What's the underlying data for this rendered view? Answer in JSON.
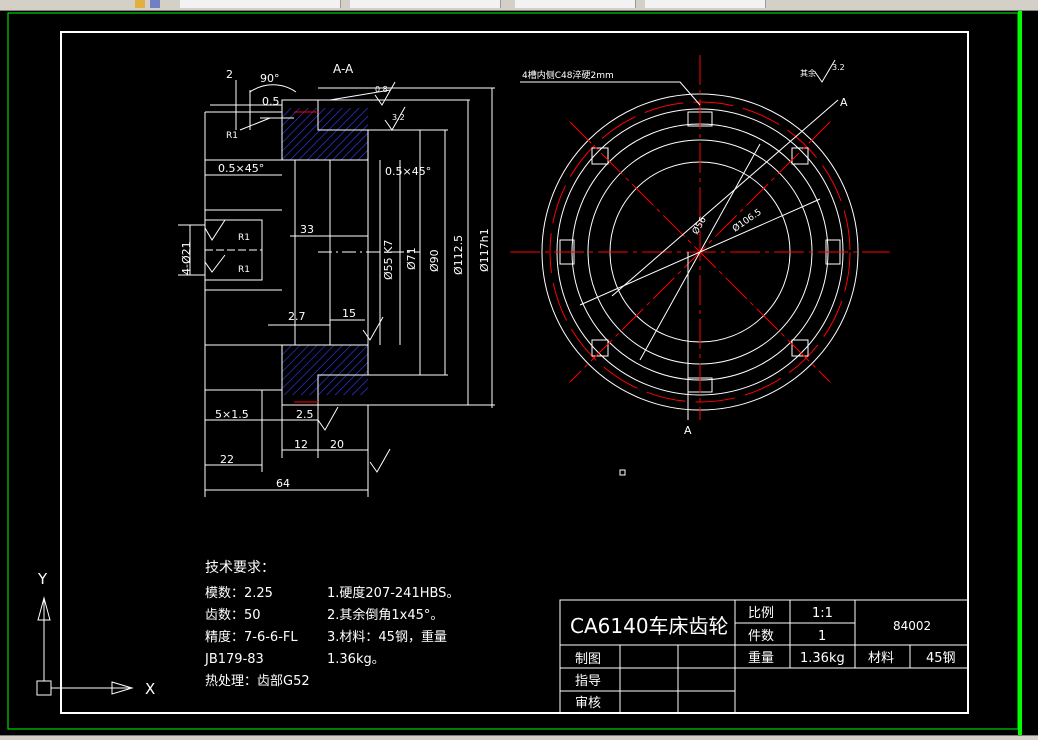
{
  "section_label": "A-A",
  "cut_marks": [
    "A",
    "A"
  ],
  "dimensions": {
    "angle": "90°",
    "chamfer_top": "0.5",
    "small_2": "2",
    "chamfer_left": "0.5×45°",
    "chamfer_right": "0.5×45°",
    "dim_33": "33",
    "bore_k7": "Ø55 K7",
    "phi_71": "Ø71",
    "phi_90": "Ø90",
    "phi_1125": "Ø112.5",
    "phi_117": "Ø117h1",
    "dim_27": "2.7",
    "dim_15": "15",
    "dim_5x15": "5×1.5",
    "dim_25": "2.5",
    "dim_12": "12",
    "dim_20": "20",
    "dim_22": "22",
    "dim_64": "64",
    "left_dim": "4-Ø21",
    "r1_a": "R1",
    "r1_b": "R1",
    "r1_c": "R1",
    "rough_08": "0.8",
    "rough_32": "3.2",
    "circle_note": "4槽内侧C48淬硬2mm",
    "phi_circle_a": "Ø56",
    "phi_circle_b": "Ø106.5",
    "other": "其余"
  },
  "tech_req": {
    "title": "技术要求：",
    "left_lines": [
      "模数：2.25",
      "齿数：50",
      "精度：7-6-6-FL",
      "JB179-83",
      "热处理：齿部G52"
    ],
    "right_lines": [
      "1.硬度207-241HBS。",
      "2.其余倒角1x45°。",
      "3.材料：45钢，重量",
      "1.36kg。"
    ]
  },
  "title_block": {
    "part_name": "CA6140车床齿轮",
    "scale_label": "比例",
    "scale_value": "1:1",
    "qty_label": "件数",
    "qty_value": "1",
    "drawing_no": "84002",
    "weight_label": "重量",
    "weight_value": "1.36kg",
    "material_label": "材料",
    "material_value": "45钢",
    "drawn_label": "制图",
    "guide_label": "指导",
    "review_label": "审核"
  },
  "ucs": {
    "x": "X",
    "y": "Y"
  },
  "colors": {
    "line": "#ffffff",
    "hatch": "#3b3bff",
    "center": "#ff0000",
    "frame": "#00ff00"
  }
}
